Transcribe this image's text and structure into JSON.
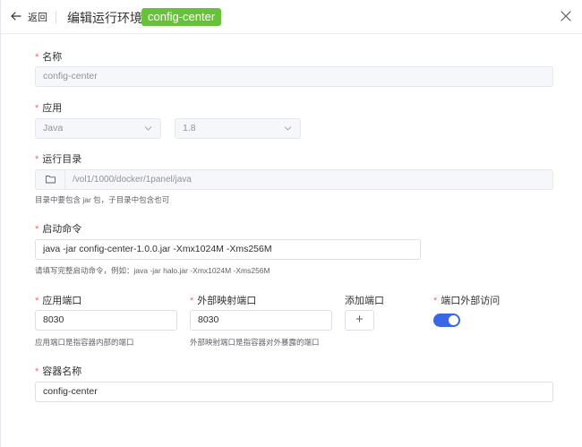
{
  "header": {
    "back_label": "返回",
    "title": "编辑运行环境 -",
    "name_tag": "config-center"
  },
  "form": {
    "name": {
      "label": "名称",
      "value": "config-center"
    },
    "app": {
      "label": "应用",
      "type_value": "Java",
      "version_value": "1.8"
    },
    "run_dir": {
      "label": "运行目录",
      "value": "/vol1/1000/docker/1panel/java",
      "help": "目录中要包含 jar 包，子目录中包含也可"
    },
    "start_command": {
      "label": "启动命令",
      "value": "java -jar config-center-1.0.0.jar -Xmx1024M -Xms256M",
      "help": "请填写完整启动命令，例如：java -jar halo.jar -Xmx1024M -Xms256M"
    },
    "app_port": {
      "label": "应用端口",
      "value": "8030",
      "help": "应用端口是指容器内部的端口"
    },
    "external_port": {
      "label": "外部映射端口",
      "value": "8030",
      "help": "外部映射端口是指容器对外暴露的端口"
    },
    "add_port": {
      "label": "添加端口",
      "button": "+"
    },
    "external_access": {
      "label": "端口外部访问",
      "enabled": true
    },
    "container_name": {
      "label": "容器名称",
      "value": "config-center"
    }
  },
  "colors": {
    "accent": "#3a67e3",
    "tag_green": "#67c23a",
    "required": "#f56c6c"
  }
}
